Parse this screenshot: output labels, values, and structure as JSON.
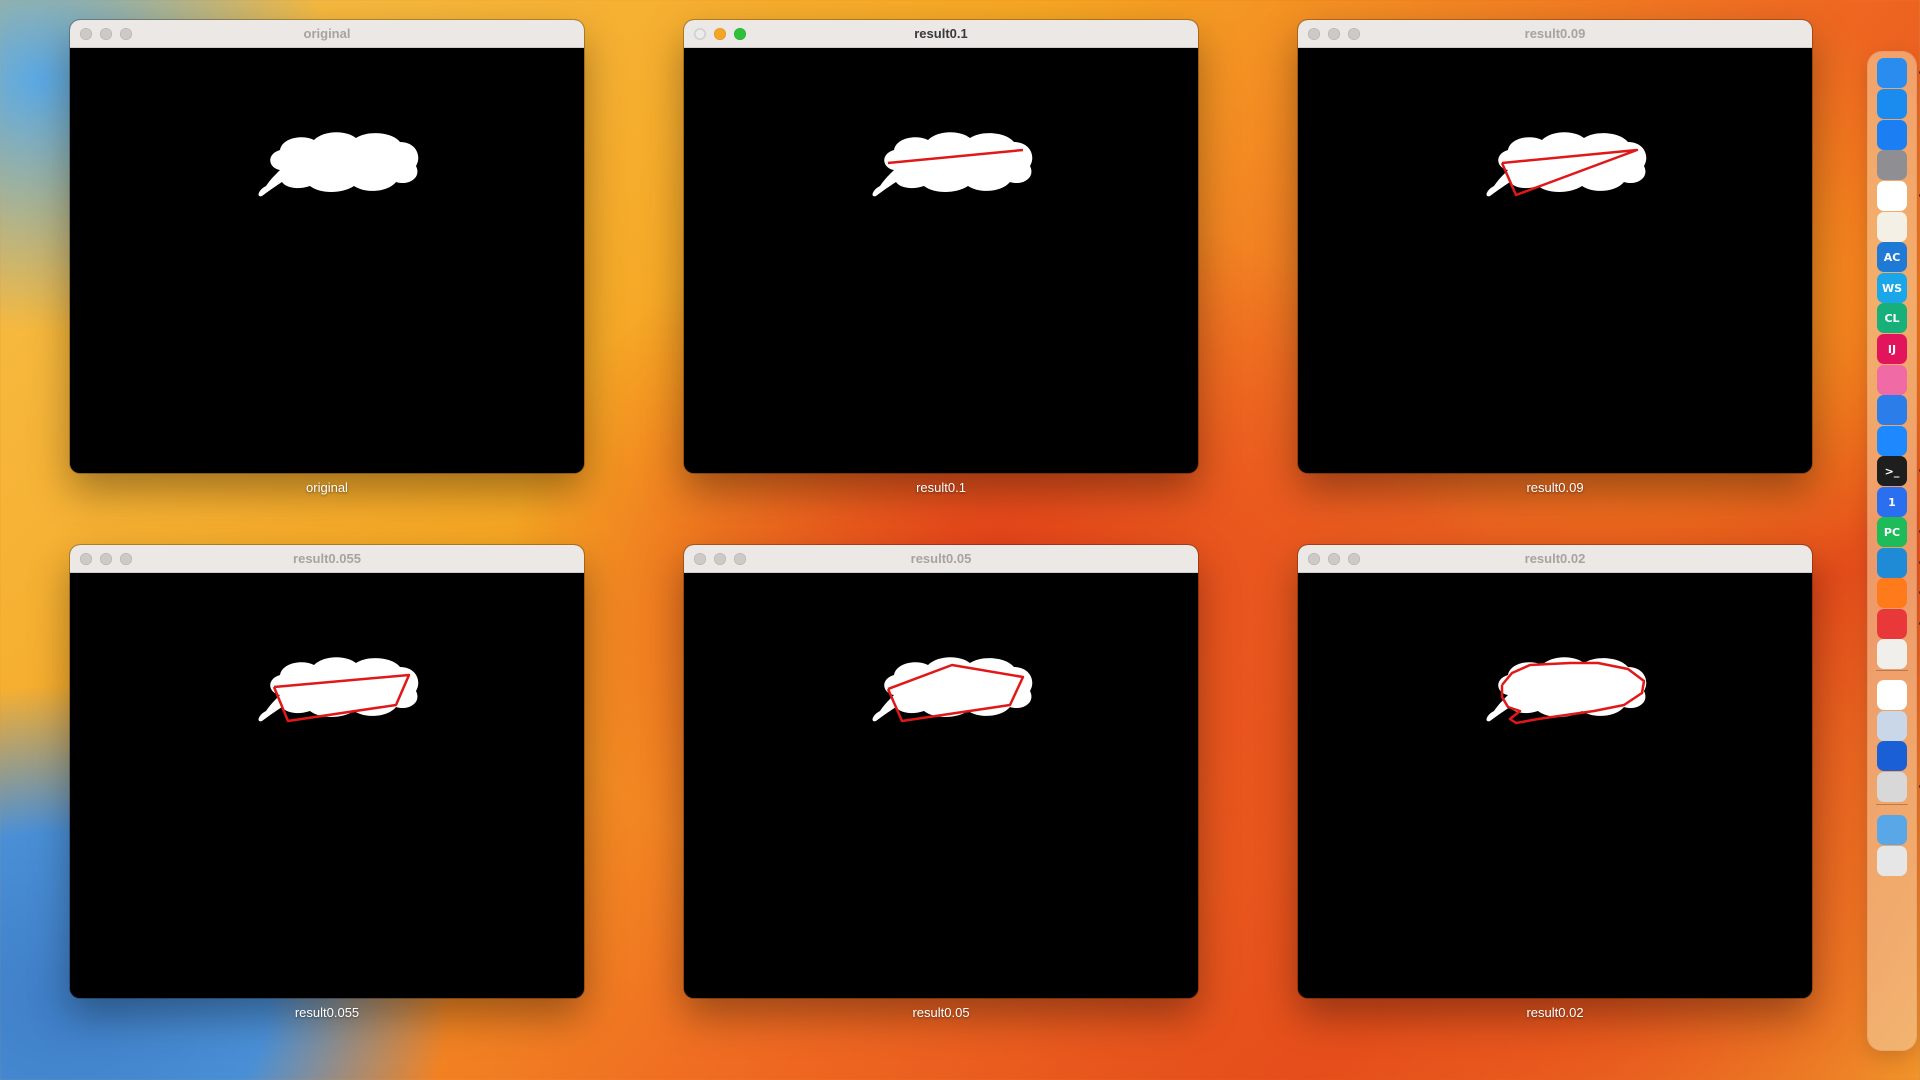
{
  "windows": [
    {
      "title": "original",
      "caption": "original",
      "active": false,
      "outline": []
    },
    {
      "title": "result0.1",
      "caption": "result0.1",
      "active": true,
      "outline": "line"
    },
    {
      "title": "result0.09",
      "caption": "result0.09",
      "active": false,
      "outline": "triangle"
    },
    {
      "title": "result0.055",
      "caption": "result0.055",
      "active": false,
      "outline": "quad"
    },
    {
      "title": "result0.05",
      "caption": "result0.05",
      "active": false,
      "outline": "pentagon"
    },
    {
      "title": "result0.02",
      "caption": "result0.02",
      "active": false,
      "outline": "fine"
    }
  ],
  "colors": {
    "contour": "#e01818",
    "shape": "#ffffff",
    "canvas": "#000000"
  },
  "dock": {
    "items": [
      {
        "name": "finder-icon",
        "label": "",
        "color": "#2b8cf0",
        "running": true
      },
      {
        "name": "safari-icon",
        "label": "",
        "color": "#1a8cf0",
        "running": false
      },
      {
        "name": "app-store-icon",
        "label": "",
        "color": "#1c7ef3",
        "running": false
      },
      {
        "name": "system-settings-icon",
        "label": "",
        "color": "#8e8e93",
        "running": false
      },
      {
        "name": "chrome-icon",
        "label": "",
        "color": "#ffffff",
        "running": true
      },
      {
        "name": "notes-icon",
        "label": "",
        "color": "#f4f0e6",
        "running": false
      },
      {
        "name": "appcode-icon",
        "label": "AC",
        "color": "#1f7ad6",
        "running": false
      },
      {
        "name": "webstorm-icon",
        "label": "WS",
        "color": "#1aa6e8",
        "running": false
      },
      {
        "name": "clion-icon",
        "label": "CL",
        "color": "#17b07a",
        "running": false
      },
      {
        "name": "intellij-icon",
        "label": "IJ",
        "color": "#e2145b",
        "running": false
      },
      {
        "name": "screen-app-icon",
        "label": "",
        "color": "#f06aa6",
        "running": false
      },
      {
        "name": "xcode-icon",
        "label": "",
        "color": "#2b7de9",
        "running": false
      },
      {
        "name": "cloud-app-icon",
        "label": "",
        "color": "#1e88ff",
        "running": false
      },
      {
        "name": "terminal-icon",
        "label": ">_",
        "color": "#1e1e1e",
        "running": true
      },
      {
        "name": "1password-icon",
        "label": "1",
        "color": "#2a6ff0",
        "running": false
      },
      {
        "name": "pycharm-icon",
        "label": "PC",
        "color": "#1dbb5a",
        "running": true
      },
      {
        "name": "vscode-icon",
        "label": "",
        "color": "#1f8ad6",
        "running": true
      },
      {
        "name": "firefox-icon",
        "label": "",
        "color": "#ff7a1a",
        "running": true
      },
      {
        "name": "recorder-icon",
        "label": "",
        "color": "#e8383a",
        "running": true
      },
      {
        "name": "launchpad-icon",
        "label": "",
        "color": "#f0efec",
        "running": false
      },
      {
        "name": "baidu-netdisk-icon",
        "label": "",
        "color": "#ffffff",
        "running": false
      },
      {
        "name": "preview-icon",
        "label": "",
        "color": "#c9d7e8",
        "running": false
      },
      {
        "name": "media-player-icon",
        "label": "",
        "color": "#1b5fd6",
        "running": false
      },
      {
        "name": "rocket-icon",
        "label": "",
        "color": "#d8d8d8",
        "running": true
      },
      {
        "name": "downloads-folder-icon",
        "label": "",
        "color": "#5aa7e8",
        "running": false
      },
      {
        "name": "trash-icon",
        "label": "",
        "color": "#e6e6e6",
        "running": false
      }
    ]
  }
}
